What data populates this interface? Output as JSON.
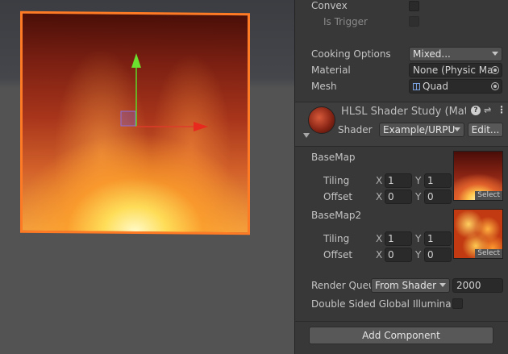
{
  "scene": {
    "view": "scene-view"
  },
  "collider": {
    "convex_label": "Convex",
    "is_trigger_label": "Is Trigger",
    "cooking_label": "Cooking Options",
    "cooking_value": "Mixed...",
    "material_label": "Material",
    "material_value": "None (Physic Ma",
    "mesh_label": "Mesh",
    "mesh_value": "Quad"
  },
  "material": {
    "name": "HLSL Shader Study (Mat",
    "shader_label": "Shader",
    "shader_value": "Example/URPU",
    "edit_label": "Edit...",
    "basemap_label": "BaseMap",
    "basemap2_label": "BaseMap2",
    "tiling_label": "Tiling",
    "offset_label": "Offset",
    "axis_x": "X",
    "axis_y": "Y",
    "basemap_tiling": [
      "1",
      "1"
    ],
    "basemap_offset": [
      "0",
      "0"
    ],
    "basemap2_tiling": [
      "1",
      "1"
    ],
    "basemap2_offset": [
      "0",
      "0"
    ],
    "select_label": "Select",
    "render_queue_label": "Render Queu",
    "render_queue_mode": "From Shader",
    "render_queue_value": "2000",
    "double_sided_label": "Double Sided Global Illuminatio"
  },
  "add_component_label": "Add Component"
}
